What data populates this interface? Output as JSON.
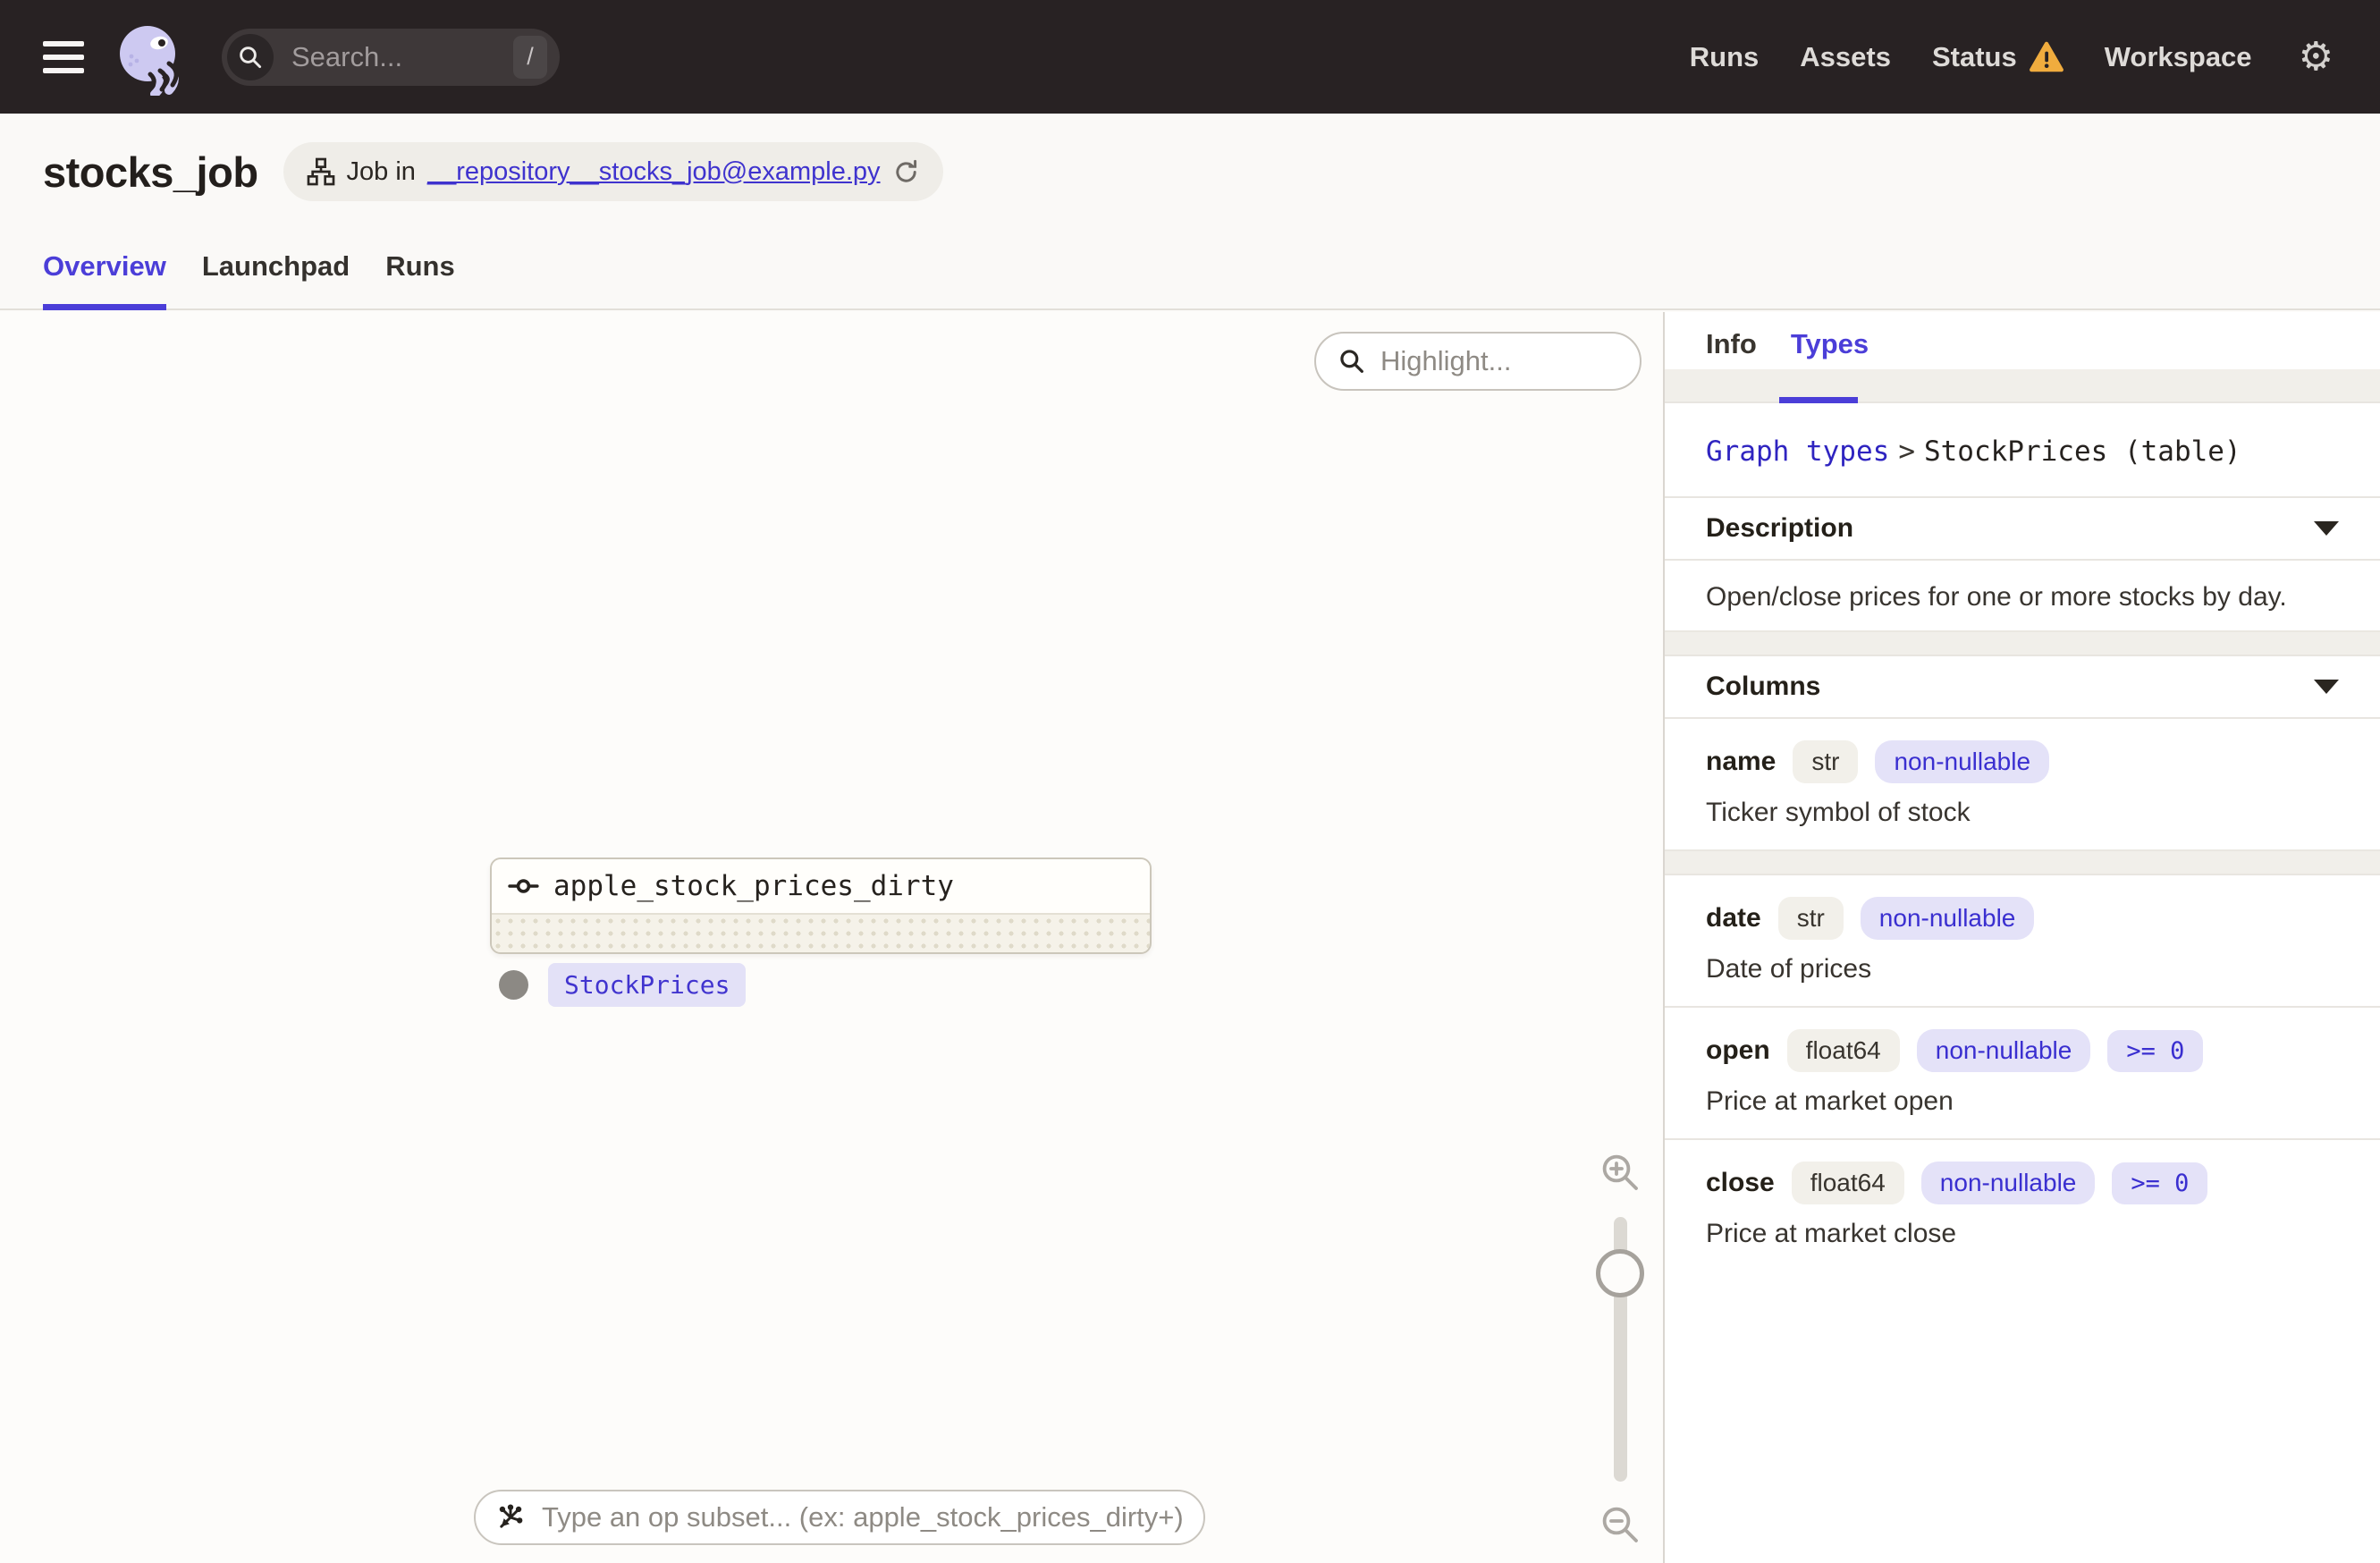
{
  "colors": {
    "accent_indigo": "#4B3ED8",
    "link_indigo": "#3C30CC",
    "warning_orange": "#F0AC3E",
    "nav_background": "#282223",
    "lavender_badge_bg": "#E4E2F8",
    "beige_badge_bg": "#F2F0EA",
    "logo_lavender": "#CDC9F1"
  },
  "nav": {
    "search": {
      "placeholder": "Search...",
      "shortcut_key": "/"
    },
    "links": [
      {
        "label": "Runs"
      },
      {
        "label": "Assets"
      },
      {
        "label": "Status",
        "has_warning": true
      },
      {
        "label": "Workspace"
      }
    ],
    "settings_icon_glyph": "⚙"
  },
  "header": {
    "title": "stocks_job",
    "job_badge": {
      "prefix": "Job in",
      "file_link": "__repository__stocks_job@example.py"
    },
    "tabs": [
      {
        "label": "Overview",
        "active": true
      },
      {
        "label": "Launchpad",
        "active": false
      },
      {
        "label": "Runs",
        "active": false
      }
    ]
  },
  "canvas": {
    "highlight_placeholder": "Highlight...",
    "op_subset_placeholder": "Type an op subset... (ex: apple_stock_prices_dirty+)",
    "node": {
      "title": "apple_stock_prices_dirty",
      "output_type_tag": "StockPrices"
    }
  },
  "panel": {
    "tabs": [
      {
        "label": "Info",
        "active": false
      },
      {
        "label": "Types",
        "active": true
      }
    ],
    "breadcrumb": {
      "link": "Graph types",
      "separator": ">",
      "current": "StockPrices (table)"
    },
    "description": {
      "title": "Description",
      "body": "Open/close prices for one or more stocks by day."
    },
    "columns": {
      "title": "Columns",
      "rows": [
        {
          "name": "name",
          "type": "str",
          "nullability": "non-nullable",
          "description": "Ticker symbol of stock"
        },
        {
          "name": "date",
          "type": "str",
          "nullability": "non-nullable",
          "description": "Date of prices"
        },
        {
          "name": "open",
          "type": "float64",
          "nullability": "non-nullable",
          "constraint": ">= 0",
          "description": "Price at market open"
        },
        {
          "name": "close",
          "type": "float64",
          "nullability": "non-nullable",
          "constraint": ">= 0",
          "description": "Price at market close"
        }
      ]
    }
  }
}
